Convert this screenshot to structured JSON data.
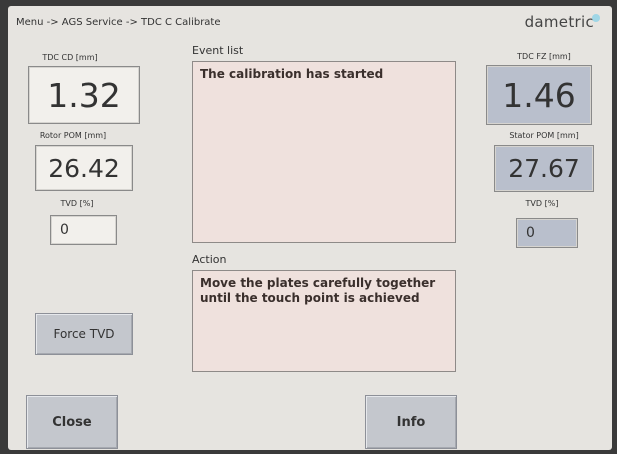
{
  "header": {
    "breadcrumb": "Menu -> AGS Service -> TDC C Calibrate",
    "logo": "dametric"
  },
  "left": {
    "tdc_cd": {
      "label": "TDC CD [mm]",
      "value": "1.32"
    },
    "rotor_pom": {
      "label": "Rotor POM [mm]",
      "value": "26.42"
    },
    "tvd": {
      "label": "TVD [%]",
      "value": "0"
    },
    "force_tvd_label": "Force TVD"
  },
  "right": {
    "tdc_fz": {
      "label": "TDC FZ [mm]",
      "value": "1.46"
    },
    "stator_pom": {
      "label": "Stator POM [mm]",
      "value": "27.67"
    },
    "tvd": {
      "label": "TVD [%]",
      "value": "0"
    }
  },
  "event_list": {
    "title": "Event list",
    "text": "The calibration has started"
  },
  "action": {
    "title": "Action",
    "line1": "Move the plates carefully together",
    "line2": "until the touch point is achieved"
  },
  "footer": {
    "close_label": "Close",
    "info_label": "Info"
  },
  "colors": {
    "screen_bg": "#e6e4e0",
    "textarea_bg": "#efe1dd",
    "highlight_box_bg": "#b9bfcc",
    "button_bg": "#c4c7cd"
  }
}
